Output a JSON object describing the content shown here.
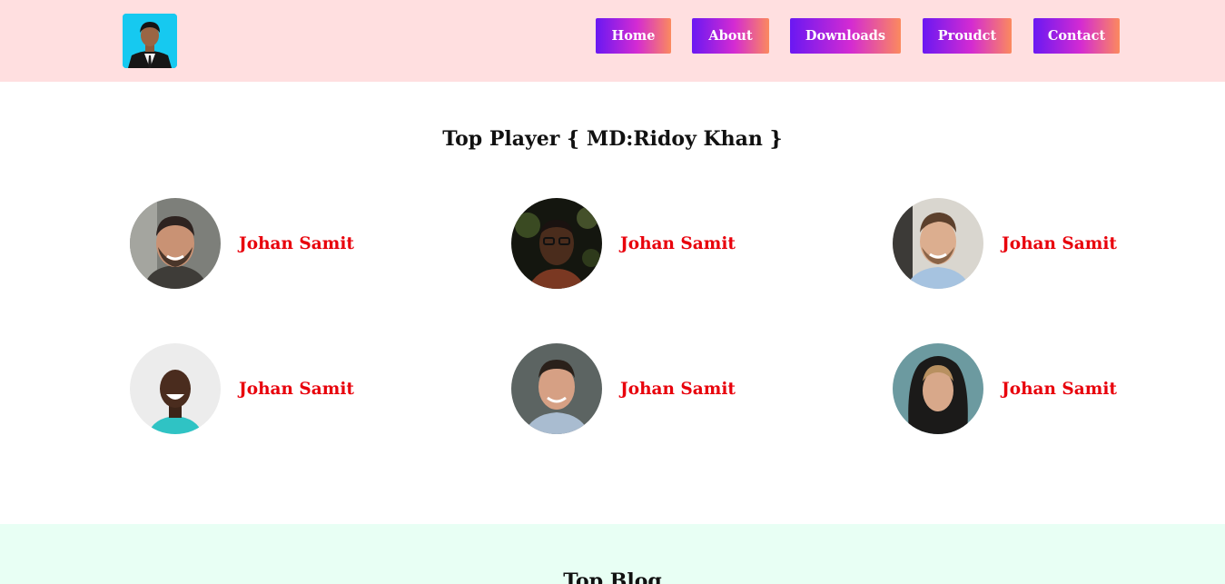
{
  "header": {
    "logo_icon": "profile-photo-logo",
    "nav": [
      {
        "label": "Home"
      },
      {
        "label": "About"
      },
      {
        "label": "Downloads"
      },
      {
        "label": "Proudct"
      },
      {
        "label": "Contact"
      }
    ],
    "nav_gradient": [
      "#6a18f2",
      "#d42bd2",
      "#fb8a5e"
    ],
    "background": "#ffdfe0"
  },
  "players_section": {
    "title": "Top Player { MD:Ridoy Khan }",
    "players": [
      {
        "name": "Johan Samit",
        "photo": "man-beard-smiling"
      },
      {
        "name": "Johan Samit",
        "photo": "man-glasses-dark"
      },
      {
        "name": "Johan Samit",
        "photo": "man-smiling-light"
      },
      {
        "name": "Johan Samit",
        "photo": "man-laughing-white-bg"
      },
      {
        "name": "Johan Samit",
        "photo": "man-smiling-grey-bg"
      },
      {
        "name": "Johan Samit",
        "photo": "man-hood-teal-bg"
      }
    ],
    "name_color": "#e8000b"
  },
  "blog_section": {
    "title": "Top Blog",
    "background": "#e8fff4"
  }
}
